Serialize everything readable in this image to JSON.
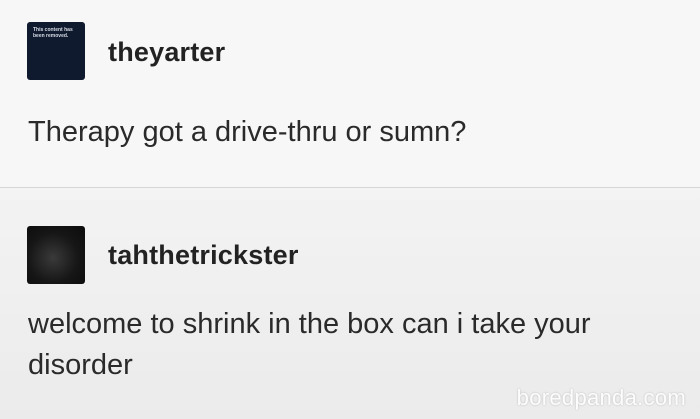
{
  "posts": [
    {
      "username": "theyarter",
      "avatar_text": "This content has been removed.",
      "text": "Therapy got a drive-thru or sumn?"
    },
    {
      "username": "tahthetrickster",
      "text": "welcome to shrink in the box can i take your disorder"
    }
  ],
  "watermark": "boredpanda.com",
  "colors": {
    "avatar_1_bg": "#0f1a2e",
    "avatar_2_bg": "#161616",
    "page_bg": "#f4f4f4",
    "text": "#1d1d1d"
  }
}
